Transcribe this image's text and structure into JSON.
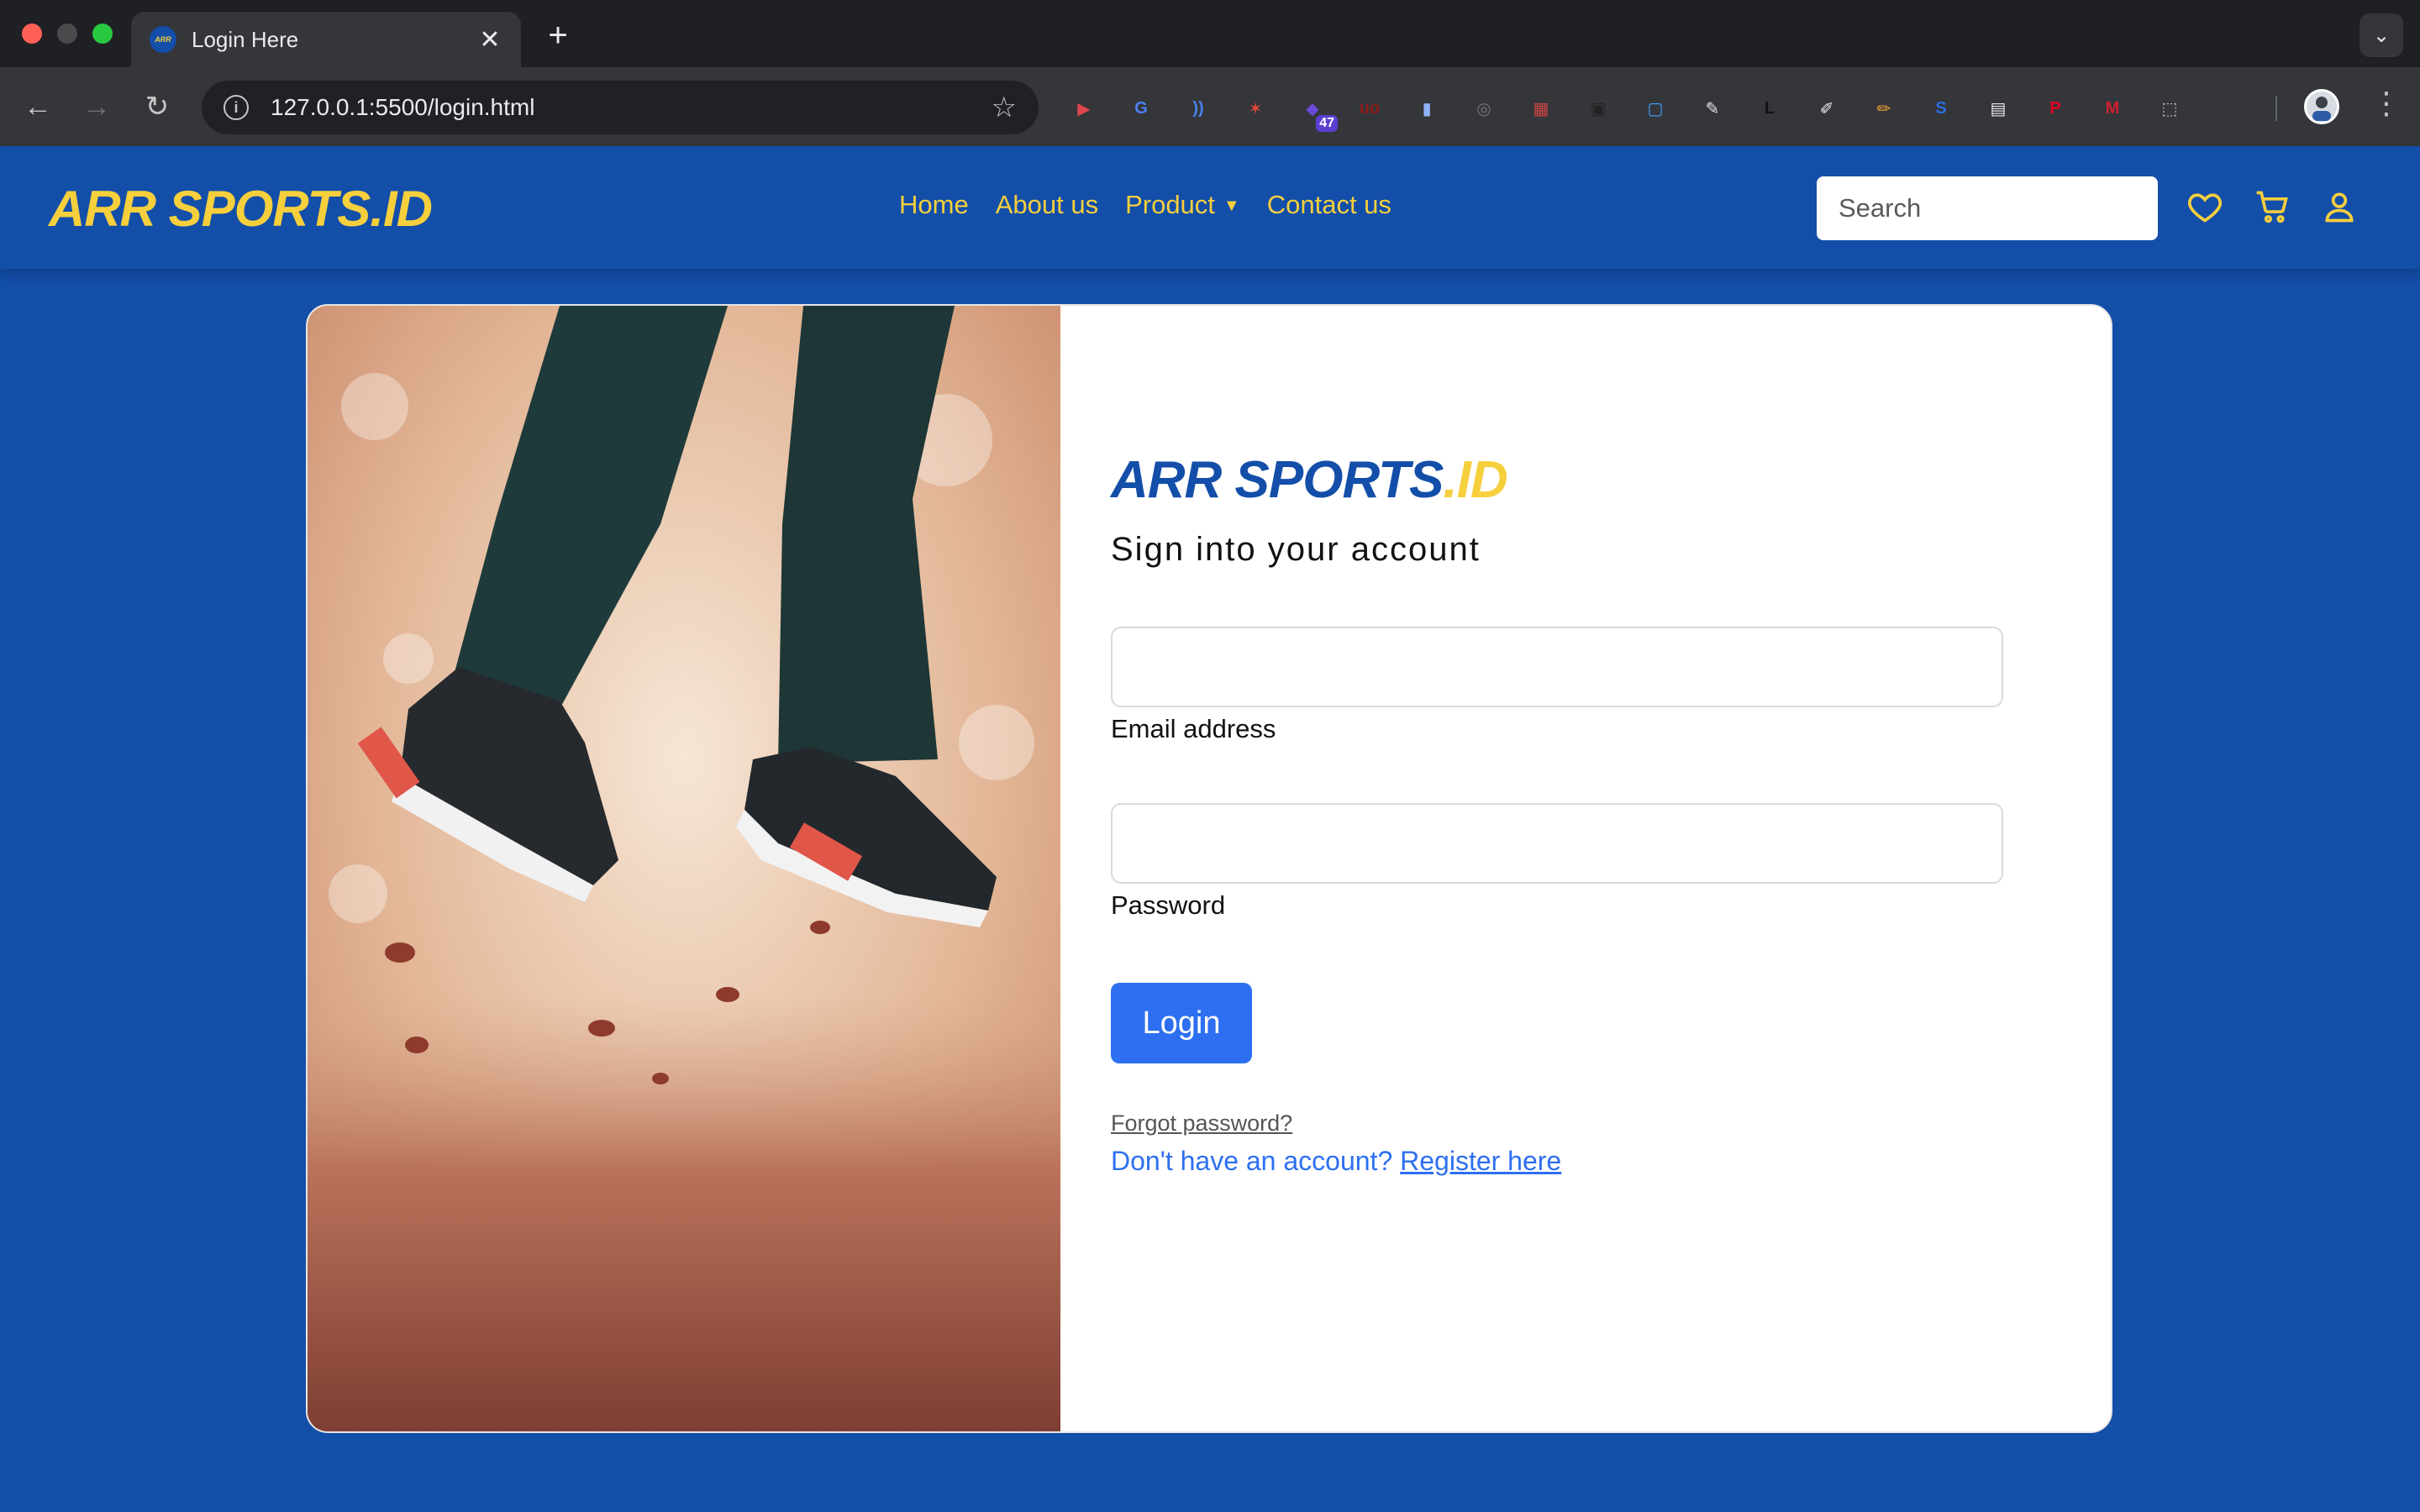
{
  "browser": {
    "tab_title": "Login Here",
    "tab_favicon_text": "ARR",
    "new_tab_symbol": "+",
    "url": "127.0.0.1:5500/login.html",
    "extensions": [
      {
        "name": "ext-red-play",
        "glyph": "▶",
        "color": "#e0454e"
      },
      {
        "name": "ext-translate",
        "glyph": "G",
        "color": "#4a80f0"
      },
      {
        "name": "ext-waves",
        "glyph": "))",
        "color": "#4a80f0"
      },
      {
        "name": "ext-red-figure",
        "glyph": "✶",
        "color": "#e5473c"
      },
      {
        "name": "ext-badge-counter",
        "glyph": "◆",
        "color": "#6a4bd8",
        "badge": "47"
      },
      {
        "name": "ext-ublock",
        "glyph": "uo",
        "color": "#8c1c1c"
      },
      {
        "name": "ext-docs",
        "glyph": "▮",
        "color": "#8fb3f7"
      },
      {
        "name": "ext-grey-circle",
        "glyph": "◎",
        "color": "#777"
      },
      {
        "name": "ext-calendar",
        "glyph": "▦",
        "color": "#c44"
      },
      {
        "name": "ext-scanner",
        "glyph": "▣",
        "color": "#222"
      },
      {
        "name": "ext-colorful",
        "glyph": "▢",
        "color": "#3aa3ff"
      },
      {
        "name": "ext-eyedropper",
        "glyph": "✎",
        "color": "#e8eaed"
      },
      {
        "name": "ext-letter-l",
        "glyph": "L",
        "color": "#111"
      },
      {
        "name": "ext-brush",
        "glyph": "✐",
        "color": "#e8eaed"
      },
      {
        "name": "ext-pencil",
        "glyph": "✏",
        "color": "#f0a030"
      },
      {
        "name": "ext-letter-s",
        "glyph": "S",
        "color": "#2a6ee0"
      },
      {
        "name": "ext-stack",
        "glyph": "▤",
        "color": "#e8eaed"
      },
      {
        "name": "ext-pinterest",
        "glyph": "P",
        "color": "#e60023"
      },
      {
        "name": "ext-mm",
        "glyph": "M",
        "color": "#d02030"
      },
      {
        "name": "ext-puzzle",
        "glyph": "⬚",
        "color": "#c4c7c5"
      }
    ]
  },
  "site": {
    "brand": "ARR SPORTS.ID",
    "nav": [
      {
        "label": "Home"
      },
      {
        "label": "About us"
      },
      {
        "label": "Product",
        "dropdown": true
      },
      {
        "label": "Contact us"
      }
    ],
    "search_placeholder": "Search",
    "accent_color": "#f6cf3c",
    "nav_bg_color": "#134ea9"
  },
  "login": {
    "brand_main": "ARR SPORTS",
    "brand_suffix": ".ID",
    "subtitle": "Sign into your account",
    "email_label": "Email address",
    "password_label": "Password",
    "login_button": "Login",
    "forgot_password": "Forgot password?",
    "register_prompt": "Don't have an account?",
    "register_link": "Register here",
    "button_color": "#2d6ff0"
  }
}
